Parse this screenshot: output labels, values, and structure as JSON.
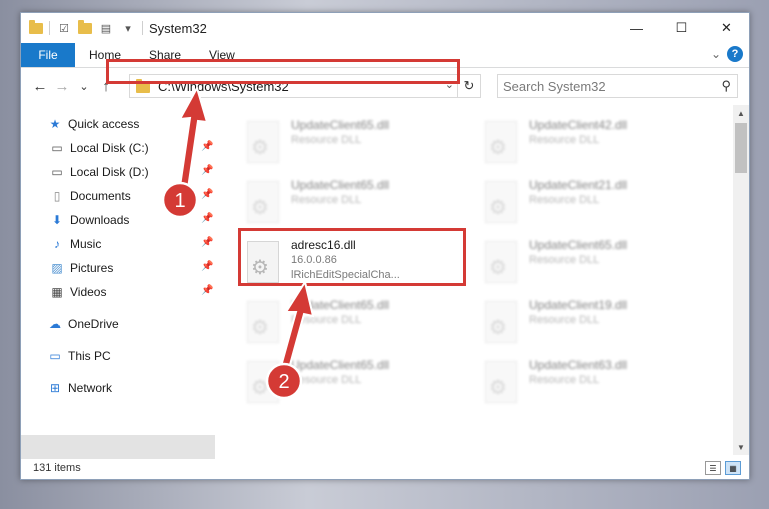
{
  "window": {
    "title": "System32",
    "controls": {
      "minimize": "—",
      "maximize": "☐",
      "close": "✕"
    }
  },
  "ribbon": {
    "tabs": [
      "File",
      "Home",
      "Share",
      "View"
    ],
    "expand_icon": "⌄",
    "help_icon": "?"
  },
  "nav": {
    "back": "←",
    "forward": "→",
    "recent": "⌄",
    "up": "↑",
    "address": "C:\\Windows\\System32",
    "address_dropdown": "⌄",
    "refresh": "↻",
    "search_placeholder": "Search System32",
    "search_icon": "⚲"
  },
  "sidebar": {
    "quick_access": "Quick access",
    "items": [
      {
        "label": "Local Disk (C:)",
        "icon": "drive-icon",
        "pinned": true
      },
      {
        "label": "Local Disk (D:)",
        "icon": "drive-icon",
        "pinned": true
      },
      {
        "label": "Documents",
        "icon": "documents-icon",
        "pinned": true
      },
      {
        "label": "Downloads",
        "icon": "download-icon",
        "pinned": true
      },
      {
        "label": "Music",
        "icon": "music-icon",
        "pinned": true
      },
      {
        "label": "Pictures",
        "icon": "pictures-icon",
        "pinned": true
      },
      {
        "label": "Videos",
        "icon": "videos-icon",
        "pinned": true
      }
    ],
    "onedrive": "OneDrive",
    "this_pc": "This PC",
    "network": "Network"
  },
  "files": {
    "highlighted": {
      "name": "adresc16.dll",
      "version": "16.0.0.86",
      "description": "lRichEditSpecialCha..."
    },
    "left_column": [
      {
        "name": "UpdateClient65.dll",
        "type": "Resource DLL"
      },
      {
        "name": "UpdateClient65.dll",
        "type": "Resource DLL"
      },
      {
        "name": "UpdateClient65.dll",
        "type": "Resource DLL"
      },
      {
        "name": "UpdateClient65.dll",
        "type": "Resource DLL"
      }
    ],
    "right_column": [
      {
        "name": "UpdateClient42.dll",
        "type": "Resource DLL"
      },
      {
        "name": "UpdateClient21.dll",
        "type": "Resource DLL"
      },
      {
        "name": "UpdateClient65.dll",
        "type": "Resource DLL"
      },
      {
        "name": "UpdateClient19.dll",
        "type": "Resource DLL"
      },
      {
        "name": "UpdateClient63.dll",
        "type": "Resource DLL"
      }
    ]
  },
  "status": {
    "items": "131 items"
  },
  "annotations": {
    "step1": "1",
    "step2": "2",
    "color": "#d43a35"
  }
}
